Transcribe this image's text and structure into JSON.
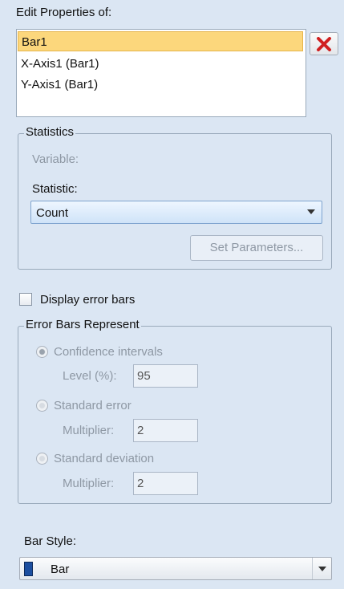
{
  "header": {
    "title": "Edit Properties of:"
  },
  "properties_list": {
    "items": [
      "Bar1",
      "X-Axis1 (Bar1)",
      "Y-Axis1 (Bar1)"
    ],
    "selected": "Bar1"
  },
  "statistics": {
    "legend": "Statistics",
    "variable_label": "Variable:",
    "statistic_label": "Statistic:",
    "statistic_value": "Count",
    "set_parameters_label": "Set Parameters..."
  },
  "error_bars": {
    "checkbox_label": "Display error bars",
    "checked": false,
    "legend": "Error Bars Represent",
    "confidence_label": "Confidence intervals",
    "level_label": "Level (%):",
    "level_value": "95",
    "standard_error_label": "Standard error",
    "se_multiplier_label": "Multiplier:",
    "se_multiplier_value": "2",
    "standard_deviation_label": "Standard deviation",
    "sd_multiplier_label": "Multiplier:",
    "sd_multiplier_value": "2"
  },
  "bar_style": {
    "label": "Bar Style:",
    "value": "Bar"
  },
  "colors": {
    "panel_bg": "#dbe6f3",
    "selection": "#fcd77c",
    "delete_icon": "#d02020",
    "bar_swatch": "#1c4fa0"
  }
}
